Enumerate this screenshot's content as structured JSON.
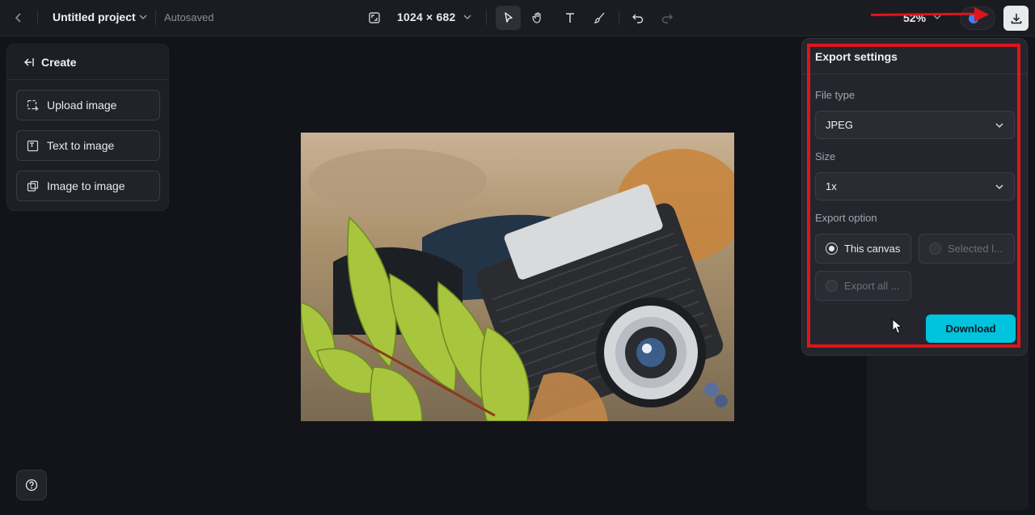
{
  "header": {
    "project_name": "Untitled project",
    "status": "Autosaved",
    "canvas_dims": "1024 × 682",
    "zoom": "52%",
    "icons": [
      "back-chevron-icon",
      "project-chevron-icon",
      "resize-icon",
      "dims-chevron-icon",
      "select-tool-icon",
      "hand-tool-icon",
      "text-tool-icon",
      "brush-tool-icon",
      "undo-icon",
      "redo-icon",
      "zoom-chevron-icon",
      "download-icon"
    ]
  },
  "left_panel": {
    "title": "Create",
    "items": [
      {
        "label": "Upload image",
        "icon": "upload-image-icon"
      },
      {
        "label": "Text to image",
        "icon": "text-to-image-icon"
      },
      {
        "label": "Image to image",
        "icon": "image-to-image-icon"
      }
    ]
  },
  "export": {
    "title": "Export settings",
    "file_type_label": "File type",
    "file_type_value": "JPEG",
    "size_label": "Size",
    "size_value": "1x",
    "option_label": "Export option",
    "options": [
      {
        "label": "This canvas",
        "selected": true,
        "enabled": true
      },
      {
        "label": "Selected l...",
        "selected": false,
        "enabled": false
      },
      {
        "label": "Export all ...",
        "selected": false,
        "enabled": false
      }
    ],
    "download_label": "Download"
  },
  "colors": {
    "accent": "#00c3dd",
    "annotation": "#e0141b",
    "background": "#13141a"
  }
}
